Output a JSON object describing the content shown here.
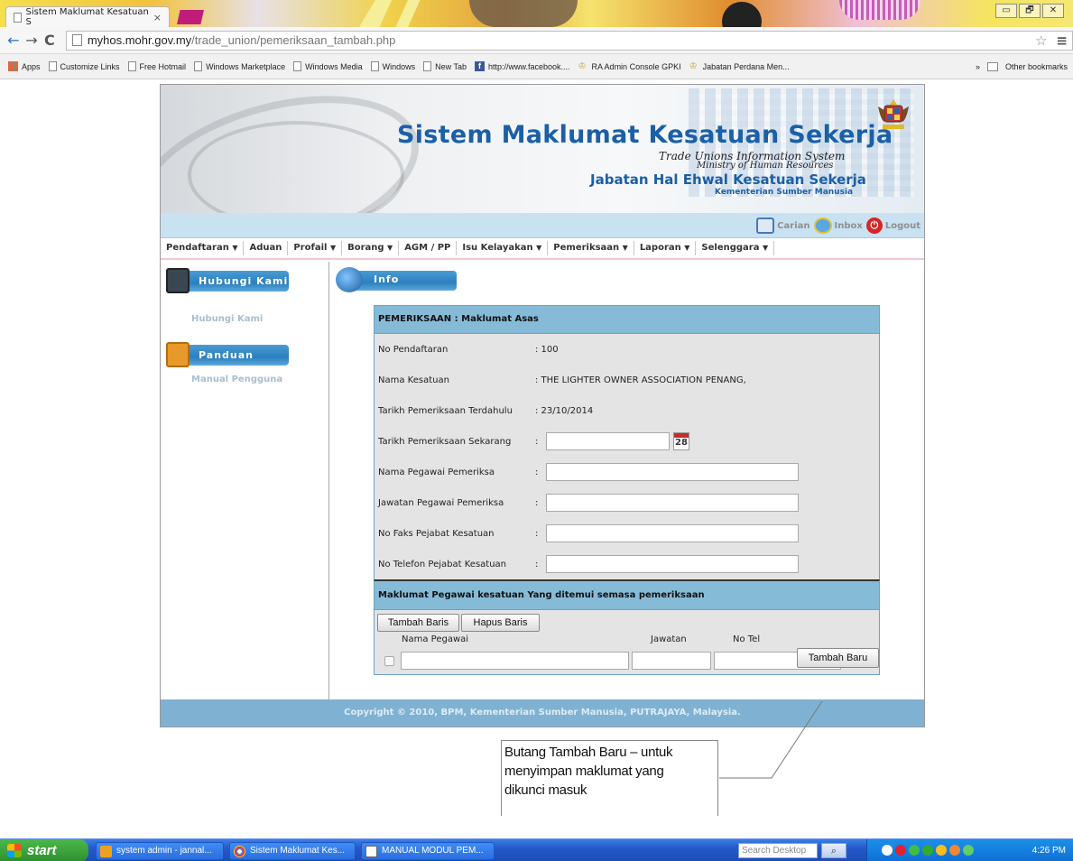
{
  "browser": {
    "tab_title": "Sistem Maklumat Kesatuan S",
    "tab_close": "×",
    "url_host": "myhos.mohr.gov.my",
    "url_path": "/trade_union/pemeriksaan_tambah.php",
    "window_controls": [
      "▭",
      "🗗",
      "✕"
    ]
  },
  "bookmarks": {
    "items": [
      {
        "label": "Apps",
        "icon": "apps-icon"
      },
      {
        "label": "Customize Links",
        "icon": "page-icon"
      },
      {
        "label": "Free Hotmail",
        "icon": "page-icon"
      },
      {
        "label": "Windows Marketplace",
        "icon": "page-icon"
      },
      {
        "label": "Windows Media",
        "icon": "page-icon"
      },
      {
        "label": "Windows",
        "icon": "page-icon"
      },
      {
        "label": "New Tab",
        "icon": "page-icon"
      },
      {
        "label": "http://www.facebook....",
        "icon": "facebook-icon"
      },
      {
        "label": "RA Admin Console GPKI",
        "icon": "crest-icon"
      },
      {
        "label": "Jabatan Perdana Men...",
        "icon": "crest-icon"
      }
    ],
    "overflow": "»",
    "other": "Other bookmarks"
  },
  "banner": {
    "title": "Sistem Maklumat Kesatuan Sekerja",
    "subtitle_en": "Trade Unions Information System",
    "ministry_en": "Ministry of Human Resources",
    "department": "Jabatan Hal Ehwal Kesatuan Sekerja",
    "ministry_ms": "Kementerian Sumber Manusia"
  },
  "top_actions": {
    "search": "Carian",
    "inbox": "Inbox",
    "logout": "Logout"
  },
  "menu": [
    {
      "label": "Pendaftaran",
      "dropdown": true
    },
    {
      "label": "Aduan",
      "dropdown": false
    },
    {
      "label": "Profail",
      "dropdown": true
    },
    {
      "label": "Borang",
      "dropdown": true
    },
    {
      "label": "AGM / PP",
      "dropdown": false
    },
    {
      "label": "Isu Kelayakan",
      "dropdown": true
    },
    {
      "label": "Pemeriksaan",
      "dropdown": true
    },
    {
      "label": "Laporan",
      "dropdown": true
    },
    {
      "label": "Selenggara",
      "dropdown": true
    }
  ],
  "sidebar": {
    "contact_header": "Hubungi Kami",
    "contact_link": "Hubungi Kami",
    "guide_header": "Panduan",
    "guide_link": "Manual Pengguna"
  },
  "main": {
    "info_header": "Info",
    "section1_title": "PEMERIKSAAN : Maklumat Asas",
    "fields": {
      "no_pendaftaran": {
        "label": "No Pendaftaran",
        "value": ": 100"
      },
      "nama_kesatuan": {
        "label": "Nama Kesatuan",
        "value": ": THE LIGHTER OWNER ASSOCIATION PENANG,"
      },
      "tarikh_terdahulu": {
        "label": "Tarikh Pemeriksaan Terdahulu",
        "value": ": 23/10/2014"
      },
      "tarikh_sekarang": {
        "label": "Tarikh Pemeriksaan Sekarang",
        "value": ""
      },
      "nama_pegawai": {
        "label": "Nama Pegawai Pemeriksa",
        "value": ""
      },
      "jawatan_pegawai": {
        "label": "Jawatan Pegawai Pemeriksa",
        "value": ""
      },
      "no_faks": {
        "label": "No Faks Pejabat Kesatuan",
        "value": ""
      },
      "no_telefon": {
        "label": "No Telefon Pejabat Kesatuan",
        "value": ""
      }
    },
    "calendar_day": "28",
    "colon": ":",
    "section2_title": "Maklumat Pegawai kesatuan Yang ditemui semasa pemeriksaan",
    "add_row_button": "Tambah Baris",
    "delete_row_button": "Hapus Baris",
    "columns": [
      "Nama Pegawai",
      "Jawatan",
      "No Tel"
    ],
    "submit_button": "Tambah Baru"
  },
  "footer": {
    "copyright": "Copyright © 2010, BPM, Kementerian Sumber Manusia, PUTRAJAYA, Malaysia."
  },
  "annotation": {
    "lines": [
      "Butang Tambah Baru – untuk",
      "menyimpan maklumat yang",
      "dikunci masuk"
    ]
  },
  "taskbar": {
    "start": "start",
    "tasks": [
      "system admin - jannal...",
      "Sistem Maklumat Kes...",
      "MANUAL MODUL PEM..."
    ],
    "search_placeholder": "Search Desktop",
    "clock": "4:26 PM"
  }
}
